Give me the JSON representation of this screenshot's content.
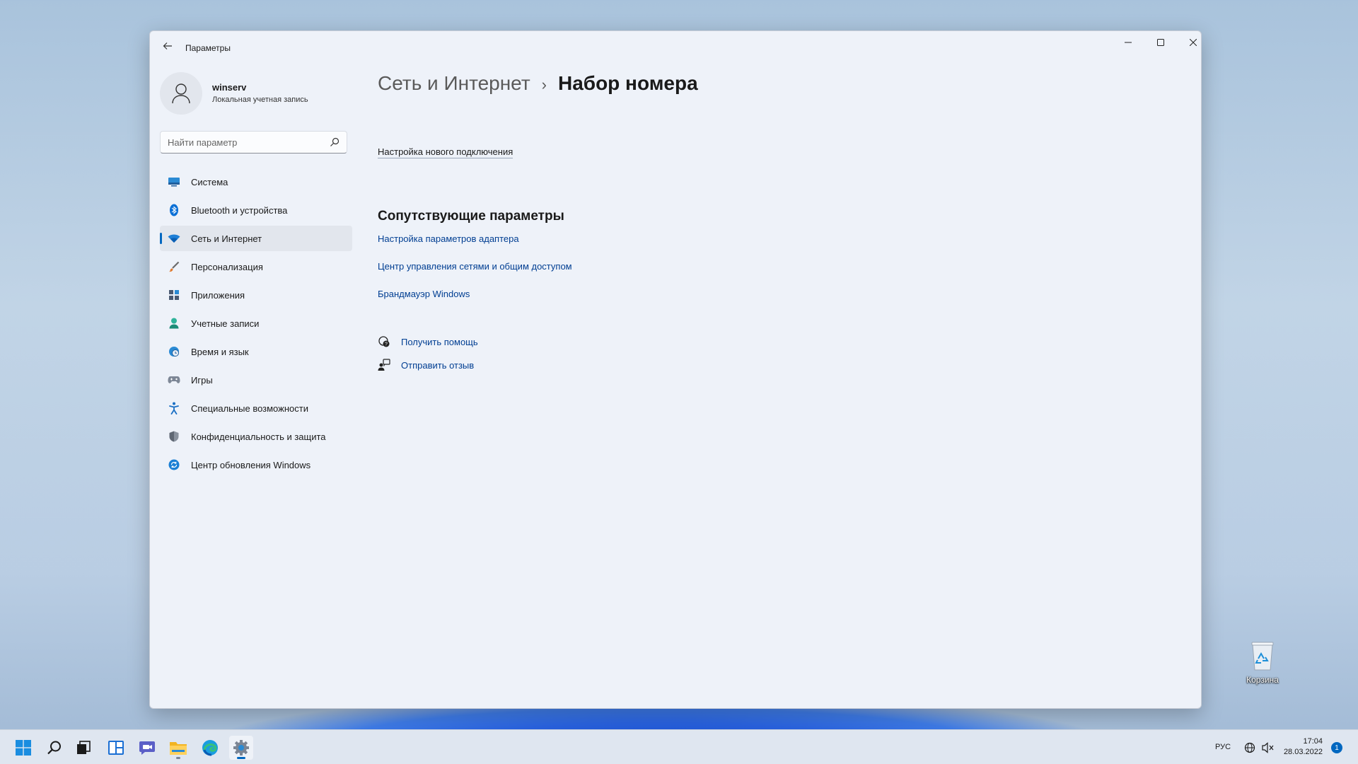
{
  "window": {
    "app_title": "Параметры",
    "controls": [
      "minimize-icon",
      "maximize-icon",
      "close-icon"
    ]
  },
  "profile": {
    "name": "winserv",
    "account_type": "Локальная учетная запись"
  },
  "search": {
    "placeholder": "Найти параметр"
  },
  "sidebar": {
    "items": [
      {
        "label": "Система",
        "icon": "monitor-icon"
      },
      {
        "label": "Bluetooth и устройства",
        "icon": "bluetooth-icon"
      },
      {
        "label": "Сеть и Интернет",
        "icon": "wifi-icon",
        "selected": true
      },
      {
        "label": "Персонализация",
        "icon": "brush-icon"
      },
      {
        "label": "Приложения",
        "icon": "apps-icon"
      },
      {
        "label": "Учетные записи",
        "icon": "person-icon"
      },
      {
        "label": "Время и язык",
        "icon": "globe-clock-icon"
      },
      {
        "label": "Игры",
        "icon": "gamepad-icon"
      },
      {
        "label": "Специальные возможности",
        "icon": "accessibility-icon"
      },
      {
        "label": "Конфиденциальность и защита",
        "icon": "shield-icon"
      },
      {
        "label": "Центр обновления Windows",
        "icon": "update-icon"
      }
    ]
  },
  "breadcrumb": {
    "parent": "Сеть и Интернет",
    "separator": "›",
    "current": "Набор номера"
  },
  "main": {
    "new_connection_link": "Настройка нового подключения",
    "related_title": "Сопутствующие параметры",
    "related_links": [
      "Настройка параметров адаптера",
      "Центр управления сетями и общим доступом",
      "Брандмауэр Windows"
    ],
    "help_links": [
      {
        "label": "Получить помощь",
        "icon": "help-icon"
      },
      {
        "label": "Отправить отзыв",
        "icon": "feedback-icon"
      }
    ]
  },
  "desktop": {
    "recycle_bin_label": "Корзина"
  },
  "taskbar": {
    "apps": [
      "start-icon",
      "search-icon",
      "task-view-icon",
      "widgets-icon",
      "chat-icon",
      "file-explorer-icon",
      "edge-icon",
      "settings-icon"
    ],
    "language": "РУС",
    "time": "17:04",
    "date": "28.03.2022",
    "notification_count": "1"
  },
  "colors": {
    "accent": "#0067c0",
    "link": "#003e92",
    "window_bg": "#eef2f9"
  }
}
